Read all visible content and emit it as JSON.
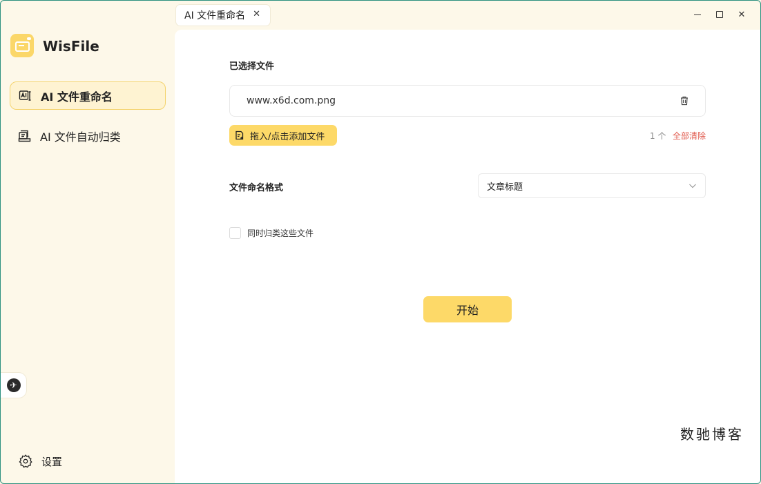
{
  "app": {
    "name": "WisFile",
    "tab_title": "AI 文件重命名"
  },
  "sidebar": {
    "items": [
      {
        "label": "AI 文件重命名",
        "icon": "ai-rename-icon",
        "active": true
      },
      {
        "label": "AI 文件自动归类",
        "icon": "ai-classify-icon",
        "active": false
      }
    ],
    "settings_label": "设置"
  },
  "main": {
    "selected_files_label": "已选择文件",
    "files": [
      {
        "name": "www.x6d.com.png"
      }
    ],
    "add_button_label": "拖入/点击添加文件",
    "file_count": "1 个",
    "clear_all_label": "全部清除",
    "naming_format_label": "文件命名格式",
    "naming_format_value": "文章标题",
    "classify_checkbox_label": "同时归类这些文件",
    "classify_checked": false,
    "start_button_label": "开始"
  },
  "watermark": "数驰博客",
  "colors": {
    "accent": "#fdd968",
    "sidebar_bg": "#fdf8e9",
    "danger": "#e0584b"
  }
}
